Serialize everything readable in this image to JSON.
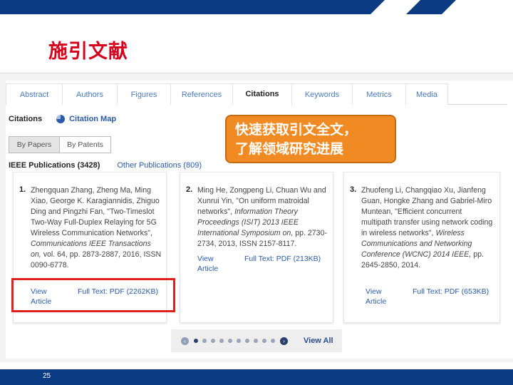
{
  "slide": {
    "title": "施引文献",
    "page_number": "25"
  },
  "tabs": [
    {
      "label": "Abstract"
    },
    {
      "label": "Authors"
    },
    {
      "label": "Figures"
    },
    {
      "label": "References"
    },
    {
      "label": "Citations",
      "active": true
    },
    {
      "label": "Keywords"
    },
    {
      "label": "Metrics"
    },
    {
      "label": "Media"
    }
  ],
  "citations": {
    "label": "Citations",
    "citation_map": "Citation Map",
    "segment": [
      "By Papers",
      "By Patents"
    ],
    "ieee_publications": "IEEE Publications (3428)",
    "other_publications": "Other Publications (809)"
  },
  "callout": {
    "line1": "快速获取引文全文，",
    "line2": "了解领域研究进展"
  },
  "cards": [
    {
      "number": "1.",
      "text_plain": "Zhengquan Zhang, Zheng Ma, Ming Xiao, George K. Karagiannidis, Zhiguo Ding and Pingzhi Fan, \"Two-Timeslot Two-Way Full-Duplex Relaying for 5G Wireless Communication Networks\",",
      "text_italic": "Communications IEEE Transactions on,",
      "text_tail": "vol. 64, pp. 2873-2887, 2016, ISSN 0090-6778.",
      "view_line1": "View",
      "view_line2": "Article",
      "full_text": "Full Text: PDF (2262KB)"
    },
    {
      "number": "2.",
      "text_plain": "Ming He, Zongpeng Li, Chuan Wu and Xunrui Yin, \"On uniform matroidal networks\",",
      "text_italic": "Information Theory Proceedings (ISIT) 2013 IEEE International Symposium on,",
      "text_tail": "pp. 2730-2734, 2013, ISSN 2157-8117.",
      "view_line1": "View",
      "view_line2": "Article",
      "full_text": "Full Text: PDF (213KB)"
    },
    {
      "number": "3.",
      "text_plain": "Zhuofeng Li, Changqiao Xu, Jianfeng Guan, Hongke Zhang and Gabriel-Miro Muntean, \"Efficient concurrent multipath transfer using network coding in wireless networks\",",
      "text_italic": "Wireless Communications and Networking Conference (WCNC) 2014 IEEE,",
      "text_tail": "pp. 2645-2850, 2014.",
      "view_line1": "View",
      "view_line2": "Article",
      "full_text": "Full Text: PDF (653KB)"
    }
  ],
  "pager": {
    "page_count": 10,
    "current": 1,
    "view_all": "View All"
  },
  "colors": {
    "title_red": "#d6001c",
    "brand_blue": "#0b3b82",
    "link_blue": "#2a5aa8",
    "callout_orange": "#f08a22",
    "highlight_red": "#e0201c"
  }
}
